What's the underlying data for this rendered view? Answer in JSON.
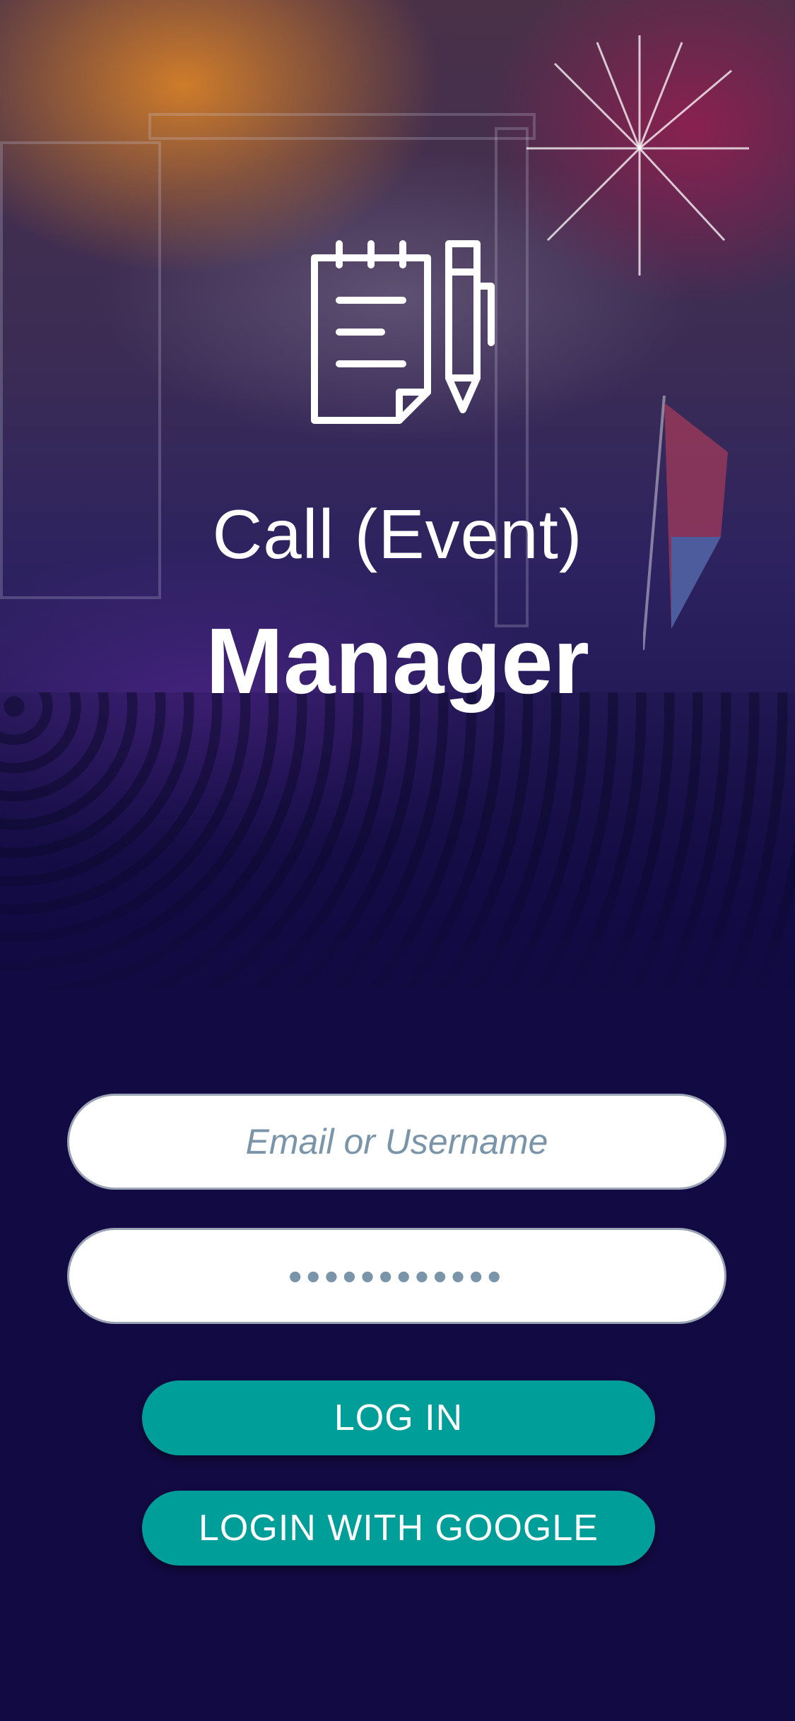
{
  "app": {
    "title_line1": "Call (Event)",
    "title_line2": "Manager",
    "logo_icon": "notepad-and-pen-icon"
  },
  "login": {
    "email_placeholder": "Email or Username",
    "password_value": "••••••••••••",
    "login_label": "LOG IN",
    "google_label": "LOGIN WITH GOOGLE"
  },
  "colors": {
    "background": "#120a42",
    "button": "#009e98",
    "placeholder": "#7a95aa"
  }
}
